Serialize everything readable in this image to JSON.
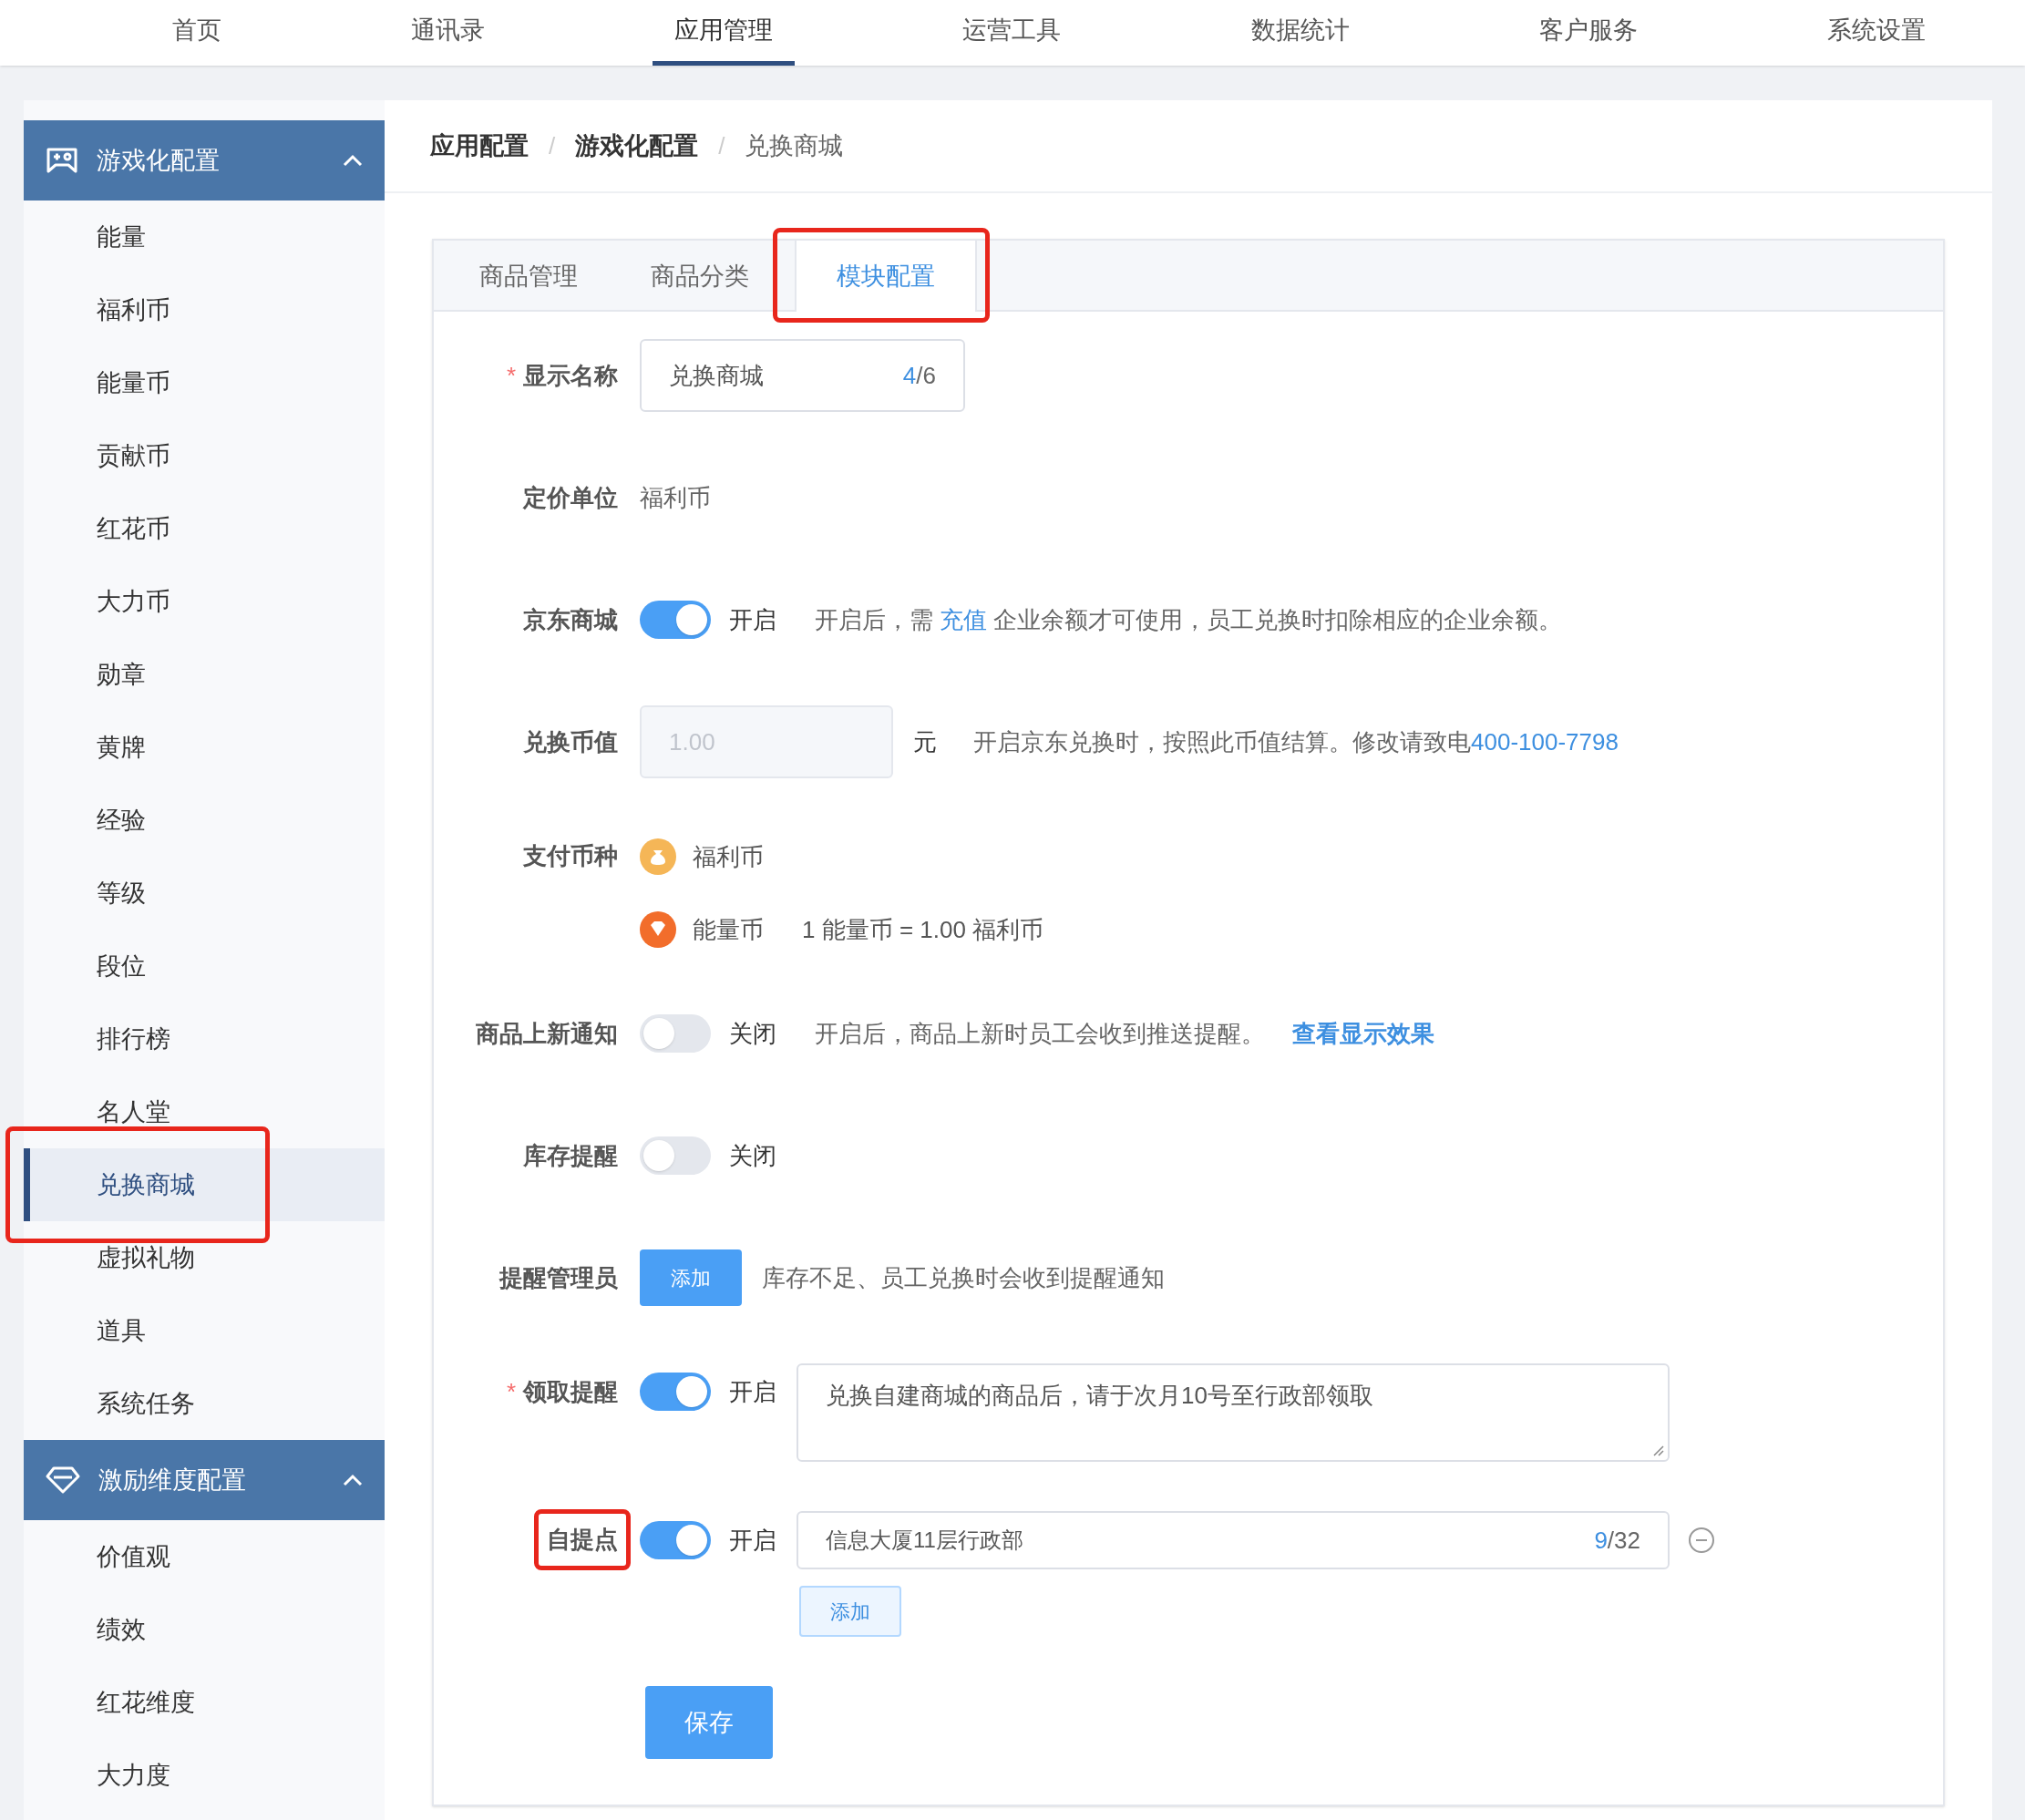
{
  "top_nav": [
    {
      "label": "首页",
      "selected": false
    },
    {
      "label": "通讯录",
      "selected": false
    },
    {
      "label": "应用管理",
      "selected": true
    },
    {
      "label": "运营工具",
      "selected": false
    },
    {
      "label": "数据统计",
      "selected": false
    },
    {
      "label": "客户服务",
      "selected": false
    },
    {
      "label": "系统设置",
      "selected": false
    }
  ],
  "sidebar": [
    {
      "title": "游戏化配置",
      "expanded": true,
      "items": [
        {
          "label": "能量",
          "selected": false
        },
        {
          "label": "福利币",
          "selected": false
        },
        {
          "label": "能量币",
          "selected": false
        },
        {
          "label": "贡献币",
          "selected": false
        },
        {
          "label": "红花币",
          "selected": false
        },
        {
          "label": "大力币",
          "selected": false
        },
        {
          "label": "勋章",
          "selected": false
        },
        {
          "label": "黄牌",
          "selected": false
        },
        {
          "label": "经验",
          "selected": false
        },
        {
          "label": "等级",
          "selected": false
        },
        {
          "label": "段位",
          "selected": false
        },
        {
          "label": "排行榜",
          "selected": false
        },
        {
          "label": "名人堂",
          "selected": false
        },
        {
          "label": "兑换商城",
          "selected": true,
          "annotated": true
        },
        {
          "label": "虚拟礼物",
          "selected": false
        },
        {
          "label": "道具",
          "selected": false
        },
        {
          "label": "系统任务",
          "selected": false
        }
      ]
    },
    {
      "title": "激励维度配置",
      "expanded": true,
      "items": [
        {
          "label": "价值观",
          "selected": false
        },
        {
          "label": "绩效",
          "selected": false
        },
        {
          "label": "红花维度",
          "selected": false
        },
        {
          "label": "大力度",
          "selected": false
        }
      ]
    }
  ],
  "breadcrumb": [
    {
      "label": "应用配置"
    },
    {
      "separator": "/",
      "label": "游戏化配置"
    },
    {
      "separator": "/",
      "label": "兑换商城"
    }
  ],
  "tabs": [
    {
      "label": "商品管理",
      "selected": false
    },
    {
      "label": "商品分类",
      "selected": false
    },
    {
      "label": "模块配置",
      "selected": true,
      "annotated": true
    }
  ],
  "form": [
    {
      "kind": "text_input",
      "label": "显示名称",
      "required_mark": "*",
      "value": "兑换商城",
      "count": "4",
      "limit": "/6"
    },
    {
      "kind": "static",
      "label": "定价单位",
      "value": "福利币"
    },
    {
      "kind": "switch",
      "label": "京东商城",
      "on": true,
      "state_label": "开启",
      "hint": "开启后，需 ",
      "link": "充值",
      "hint_after": " 企业余额才可使用，员工兑换时扣除相应的企业余额。"
    },
    {
      "kind": "disabled_input",
      "label": "兑换币值",
      "value": "1.00",
      "unit": "元",
      "hint": "开启京东兑换时，按照此币值结算。修改请致电",
      "link": "400-100-7798"
    },
    {
      "kind": "currencies",
      "label": "支付币种",
      "items": [
        {
          "name": "福利币"
        },
        {
          "name": "能量币",
          "note": "1 能量币 = 1.00 福利币"
        }
      ]
    },
    {
      "kind": "switch",
      "label": "商品上新通知",
      "on": false,
      "state_label": "关闭",
      "hint": "开启后，商品上新时员工会收到推送提醒。",
      "action_link": "查看显示效果"
    },
    {
      "kind": "switch",
      "label": "库存提醒",
      "on": false,
      "state_label": "关闭"
    },
    {
      "kind": "button",
      "label": "提醒管理员",
      "button": "添加",
      "hint": "库存不足、员工兑换时会收到提醒通知"
    },
    {
      "kind": "switch_textarea",
      "label": "领取提醒",
      "required_mark": "*",
      "on": true,
      "state_label": "开启",
      "value": "兑换自建商城的商品后，请于次月10号至行政部领取"
    },
    {
      "kind": "pickup",
      "label": "自提点",
      "annotated": true,
      "on": true,
      "state_label": "开启",
      "value": "信息大厦11层行政部",
      "count": "9",
      "limit": "/32",
      "add": "添加"
    }
  ],
  "save": "保存"
}
